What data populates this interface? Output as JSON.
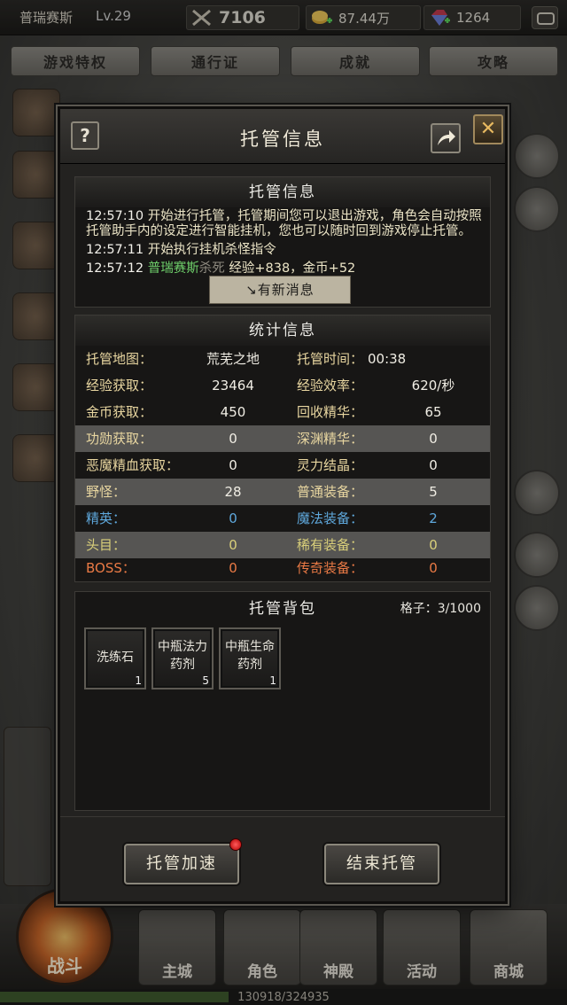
{
  "topbar": {
    "player_name": "普瑞赛斯",
    "level": "Lv.29",
    "combat_power": "7106",
    "gold": "87.44万",
    "gems": "1264"
  },
  "top_tabs": [
    {
      "label": "游戏特权"
    },
    {
      "label": "通行证"
    },
    {
      "label": "成就"
    },
    {
      "label": "攻略"
    }
  ],
  "bottom_nav": {
    "battle": "战斗",
    "items": [
      {
        "label": "主城"
      },
      {
        "label": "角色"
      },
      {
        "label": "神殿"
      },
      {
        "label": "活动"
      },
      {
        "label": "商城"
      }
    ],
    "exp_text": "130918/324935",
    "exp_fraction": 0.403
  },
  "dialog": {
    "title": "托管信息",
    "help": "?",
    "close": "✕",
    "log": {
      "title": "托管信息",
      "entries": [
        {
          "time": "12:57:10",
          "text": "开始进行托管，托管期间您可以退出游戏，角色会自动按照托管助手内的设定进行智能挂机，您也可以随时回到游戏停止托管。"
        },
        {
          "time": "12:57:11",
          "text": "开始执行挂机杀怪指令"
        },
        {
          "time": "12:57:12",
          "actor": "普瑞赛斯",
          "action": "杀死",
          "rest": "经验+838，金币+52"
        }
      ],
      "new_message": "↘有新消息"
    },
    "stats": {
      "title": "统计信息",
      "rows": [
        {
          "l1": "托管地图：",
          "v1": "荒芜之地",
          "l2": "托管时间：",
          "v2": "00:38"
        },
        {
          "l1": "经验获取：",
          "v1": "23464",
          "l2": "经验效率：",
          "v2": "620/秒"
        },
        {
          "l1": "金币获取：",
          "v1": "450",
          "l2": "回收精华：",
          "v2": "65"
        },
        {
          "l1": "功勋获取：",
          "v1": "0",
          "l2": "深渊精华：",
          "v2": "0"
        },
        {
          "l1": "恶魔精血获取：",
          "v1": "0",
          "l2": "灵力结晶：",
          "v2": "0"
        },
        {
          "l1": "野怪：",
          "v1": "28",
          "l2": "普通装备：",
          "v2": "5"
        },
        {
          "l1": "精英：",
          "v1": "0",
          "l2": "魔法装备：",
          "v2": "2"
        },
        {
          "l1": "头目：",
          "v1": "0",
          "l2": "稀有装备：",
          "v2": "0"
        },
        {
          "l1": "BOSS：",
          "v1": "0",
          "l2": "传奇装备：",
          "v2": "0"
        }
      ]
    },
    "bag": {
      "title": "托管背包",
      "capacity": "格子：3/1000",
      "items": [
        {
          "name": "洗练石",
          "qty": "1"
        },
        {
          "name": "中瓶法力药剂",
          "qty": "5"
        },
        {
          "name": "中瓶生命药剂",
          "qty": "1"
        }
      ]
    },
    "buttons": {
      "speedup": "托管加速",
      "end": "结束托管"
    }
  }
}
